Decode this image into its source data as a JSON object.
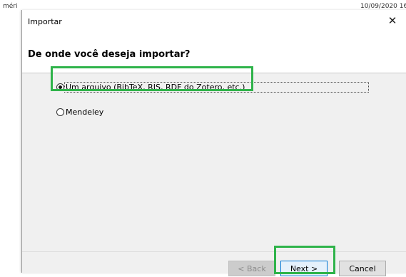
{
  "background": {
    "left_text": "méri    ",
    "right_text": "10/09/2020 16"
  },
  "dialog": {
    "title": "Importar",
    "close_glyph": "✕",
    "heading": "De onde você deseja importar?",
    "options": [
      {
        "label": "Um arquivo (BibTeX, RIS, RDF do Zotero, etc.)",
        "selected": true
      },
      {
        "label": "Mendeley",
        "selected": false
      }
    ],
    "buttons": {
      "back": "< Back",
      "next": "Next >",
      "cancel": "Cancel"
    }
  },
  "colors": {
    "highlight": "#2fb34a",
    "content_bg": "#f0f0f0"
  }
}
